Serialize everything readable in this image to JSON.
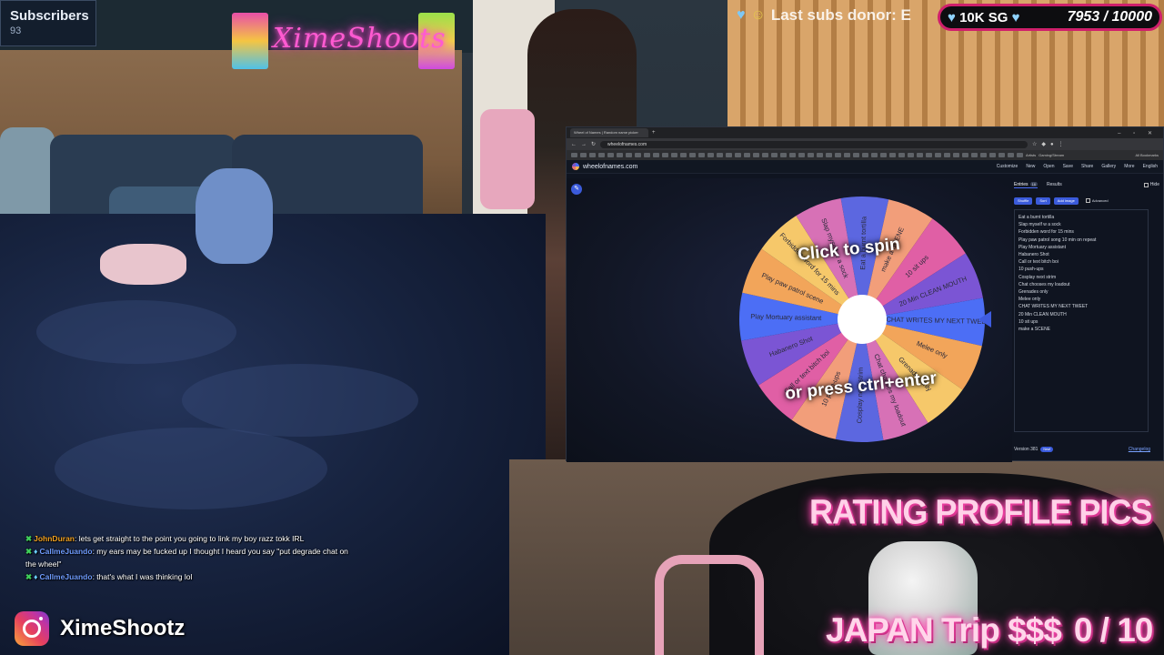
{
  "subscribers": {
    "title": "Subscribers",
    "count": "93"
  },
  "neon_sign": {
    "text": "XimeShoots"
  },
  "ticker": {
    "text": "Last subs donor: E"
  },
  "donation_goal": {
    "label": "10K SG",
    "progress": "7953 / 10000",
    "current": 7953,
    "target": 10000,
    "border_color": "#cf1f6b"
  },
  "browser": {
    "tab_title": "Wheel of Names | Random name picker",
    "url": "wheelofnames.com",
    "bookmarks_folder_1": "Artists",
    "bookmarks_folder_2": "Gaming/Stream",
    "bookmarks_folder_3": "All Bookmarks"
  },
  "site": {
    "logo": "wheelofnames.com",
    "menu": [
      "Customize",
      "New",
      "Open",
      "Save",
      "Share",
      "Gallery",
      "More",
      "English"
    ]
  },
  "wheel": {
    "cta_top": "Click to spin",
    "cta_bottom": "or press ctrl+enter",
    "slices": [
      "Eat a burnt tortilla",
      "make a SCENE",
      "10 sit ups",
      "20 Min CLEAN MOUTH",
      "CHAT WRITES MY NEXT TWEET",
      "Melee only",
      "Grenades only",
      "Chat chooses my loadout",
      "Cosplay next strim",
      "10 push-ups",
      "Call or text bitch boi",
      "Habanero Shot",
      "Play Mortuary assistant",
      "Play paw patrol scene",
      "Forbidden word for 15 mins",
      "Slap myself w a sock"
    ],
    "colors": [
      "#5c67e0",
      "#f29e7a",
      "#e05fa5",
      "#7b55d4",
      "#4c6ef5",
      "#f2a55a",
      "#f6c86a",
      "#d771b6"
    ]
  },
  "sidebar": {
    "tab_entries": "Entries",
    "entries_count": "16",
    "tab_results": "Results",
    "hide_label": "Hide",
    "btn_shuffle": "Shuffle",
    "btn_sort": "Sort",
    "btn_add_image": "Add image",
    "advanced_label": "Advanced",
    "entries": [
      "Eat a burnt tortilla",
      "Slap myself w a sock",
      "Forbidden word for 15 mins",
      "Play paw patrol song 10 min on repeat",
      "Play Mortuary assistant",
      "Habanero Shot",
      "Call or text bitch boi",
      "10 push-ups",
      "Cosplay next strim",
      "Chat chooses my loadout",
      "Grenades only",
      "Melee only",
      "CHAT WRITES MY NEXT TWEET",
      "20 Min CLEAN MOUTH",
      "10 sit ups",
      "make a SCENE"
    ],
    "version": "Version 381",
    "version_badge": "New!",
    "changelog": "Changelog"
  },
  "overlay": {
    "rating_title": "RATING PROFILE PICS",
    "japan_label": "JAPAN Trip $$$",
    "japan_progress": "0 / 10"
  },
  "chat": [
    {
      "user": "JohnDuran",
      "color": "orange",
      "message": ": lets get straight to the point you going to link my boy razz tokk IRL"
    },
    {
      "user": "CallmeJuando",
      "color": "blue",
      "message": ": my ears may be fucked up I thought I heard you say \"put degrade chat on the wheel\""
    },
    {
      "user": "CallmeJuando",
      "color": "blue",
      "message": ": that's what I was thinking lol"
    }
  ],
  "instagram": {
    "handle": "XimeShootz",
    "icon": "instagram-icon"
  }
}
